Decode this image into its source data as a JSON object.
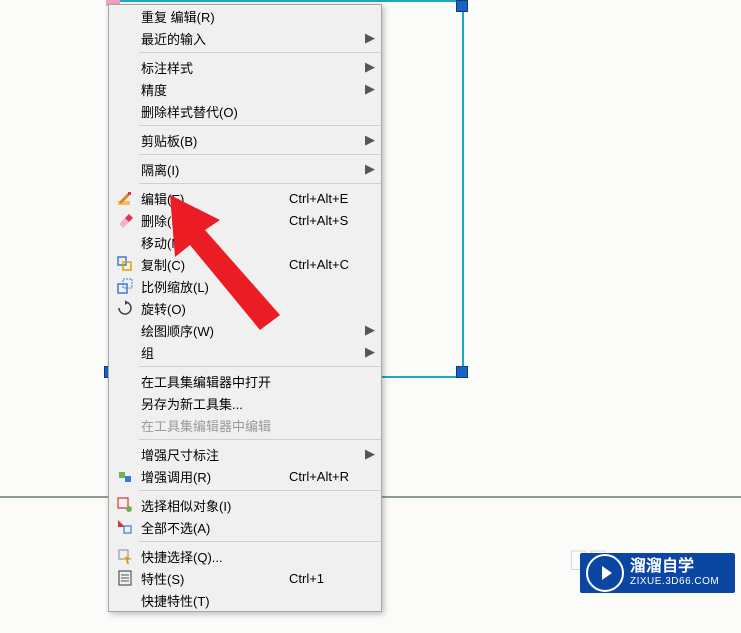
{
  "menu": {
    "repeat_edit": "重复 编辑(R)",
    "recent_input": "最近的输入",
    "dim_style": "标注样式",
    "precision": "精度",
    "del_style_override": "删除样式替代(O)",
    "clipboard": "剪贴板(B)",
    "isolate": "隔离(I)",
    "edit": "编辑(E)",
    "edit_sc": "Ctrl+Alt+E",
    "delete": "删除(S)",
    "delete_sc": "Ctrl+Alt+S",
    "move": "移动(M)",
    "copy": "复制(C)",
    "copy_sc": "Ctrl+Alt+C",
    "scale": "比例缩放(L)",
    "rotate": "旋转(O)",
    "draw_order": "绘图顺序(W)",
    "group": "组",
    "open_in_palette_editor": "在工具集编辑器中打开",
    "save_as_new_palette": "另存为新工具集...",
    "edit_in_palette_editor": "在工具集编辑器中编辑",
    "enhance_dim": "增强尺寸标注",
    "enhance_call": "增强调用(R)",
    "enhance_call_sc": "Ctrl+Alt+R",
    "select_similar": "选择相似对象(I)",
    "deselect_all": "全部不选(A)",
    "quick_select": "快捷选择(Q)...",
    "properties": "特性(S)",
    "properties_sc": "Ctrl+1",
    "quick_properties": "快捷特性(T)"
  },
  "brand": {
    "name": "溜溜自学",
    "sub": "ZIXUE.3D66.COM"
  }
}
